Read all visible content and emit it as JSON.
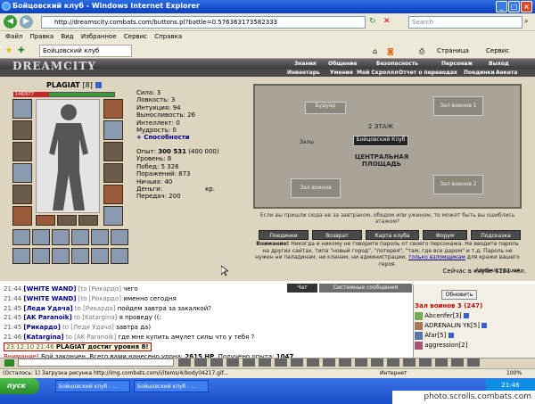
{
  "window": {
    "title": "Бойцовский клуб - Windows Internet Explorer"
  },
  "address": {
    "url": "http://dreamscity.combats.com/buttons.pl?battle=0.576363173582333",
    "search_placeholder": "Search"
  },
  "menu": [
    "Файл",
    "Правка",
    "Вид",
    "Избранное",
    "Сервис",
    "Справка"
  ],
  "tab": {
    "label": "Бойцовский клуб",
    "page_menu": "Страница",
    "tools_menu": "Сервис"
  },
  "game": {
    "logo": "DREAMCITY",
    "top_nav": [
      "Знания",
      "Общение",
      "Безопасность",
      "Персонаж",
      "Выход"
    ],
    "sub_nav": [
      "Инвентарь",
      "Умения",
      "Мой Скроллл",
      "Отчет о переводах",
      "Поединки",
      "Анкета"
    ],
    "character": {
      "name": "PLAGIAT",
      "level": "[8]",
      "hp": "146/977",
      "stats": [
        "Сила: 3",
        "Ловкость: 3",
        "Интуиция: 94",
        "Выносливость: 26",
        "Интеллект: 0",
        "Мудрость: 0"
      ],
      "abilities_link": "+ Способности",
      "exp_label": "Опыт:",
      "exp_value": "300 531",
      "exp_next": "(400 000)",
      "details": [
        "Уровень: 8",
        "Побед: 5 326",
        "Поражений: 873",
        "Ничьих: 40",
        "Деньги:",
        "Передач: 200"
      ],
      "money_unit": "кр."
    },
    "map": {
      "rooms": [
        "Будуар",
        "Зал воинов 1",
        "Залы",
        "2 ЭТАЖ",
        "Бойцовский Клуб",
        "ЦЕНТРАЛЬНАЯ ПЛОЩАДЬ",
        "Зал воинов",
        "Зал воинов 2"
      ],
      "hint": "Если вы пришли сюда не за завтраком, обедом или ужином, то может быть вы ошиблись этажом?"
    },
    "buttons": [
      "Поединки",
      "Возврат",
      "Карта клуба",
      "Форум",
      "Подсказка"
    ],
    "warning_label": "Внимание!",
    "warning_text": "Никогда и никому не говорите пароль от своего персонажа. Не вводите пароль на других сайтах, типа \"новый город\", \"лотерея\", \"там, где все даром\" и т.д. Пароль не нужен ни паладинам, ни кланам, ни администрации,",
    "warning_link": "только взломщикам",
    "warning_tail": "для кражи вашего героя.",
    "admin_sign": "Администрация.",
    "online": "Сейчас в клубе 1161 чел."
  },
  "chat": {
    "tabs": [
      "Чат",
      "Системные сообщения"
    ],
    "messages": [
      {
        "time": "21:44",
        "nick": "[WHITE WAND]",
        "to": "[to [Рикардо]",
        "text": "чего"
      },
      {
        "time": "21:44",
        "nick": "[WHITE WAND]",
        "to": "[to [Рикардо]",
        "text": "именно сегодня"
      },
      {
        "time": "21:45",
        "nick": "[Леди Удача]",
        "to": "to [Рикардо]",
        "text": "пойдем завтра за закалкой?"
      },
      {
        "time": "21:45",
        "nick": "[AK Paranoik]",
        "to": "to [Katargina]",
        "text": "я проведу ((:"
      },
      {
        "time": "21:45",
        "nick": "[Рикардо]",
        "to": "to [Леди Удача]",
        "text": "завтра да)"
      },
      {
        "time": "21:46",
        "nick": "[Katargina]",
        "to": "to [AK Paranoik]",
        "text": "где мне купить амулет силы что у тебя ?"
      }
    ],
    "system_stamp": "23.12.10 21:46",
    "system_text": "PLAGIAT достиг уровня 8!",
    "battle_label": "Внимание!",
    "battle_text": "Бой закончен. Всего вами нанесено урона:",
    "damage": "2615 HP",
    "exp_text": ". Получено опыта:",
    "exp_gain": "1047"
  },
  "sidebar": {
    "refresh": "Обновить",
    "room_title": "Зал воинов 3 (247)",
    "users": [
      "Abcenfer[3]",
      "ADRENALIN YK[5]",
      "Afar[5]",
      "aggression[2]"
    ]
  },
  "statusbar": {
    "text": "(Осталось: 1) Загрузка рисунка http://img.combats.com/i/items/4/body04217.gif...",
    "zone": "Интернет",
    "zoom": "100%"
  },
  "taskbar": {
    "start": "пуск",
    "tasks": [
      "Бойцовский клуб - ...",
      "Бойцовский клуб - ..."
    ],
    "clock": "21:46"
  },
  "watermark": "photo.scrolls.combats.com",
  "colors": {
    "title_blue": "#0a3fc2",
    "hp_red": "#c62828",
    "nick_blue": "#00008b",
    "alert_red": "#cc0000"
  }
}
